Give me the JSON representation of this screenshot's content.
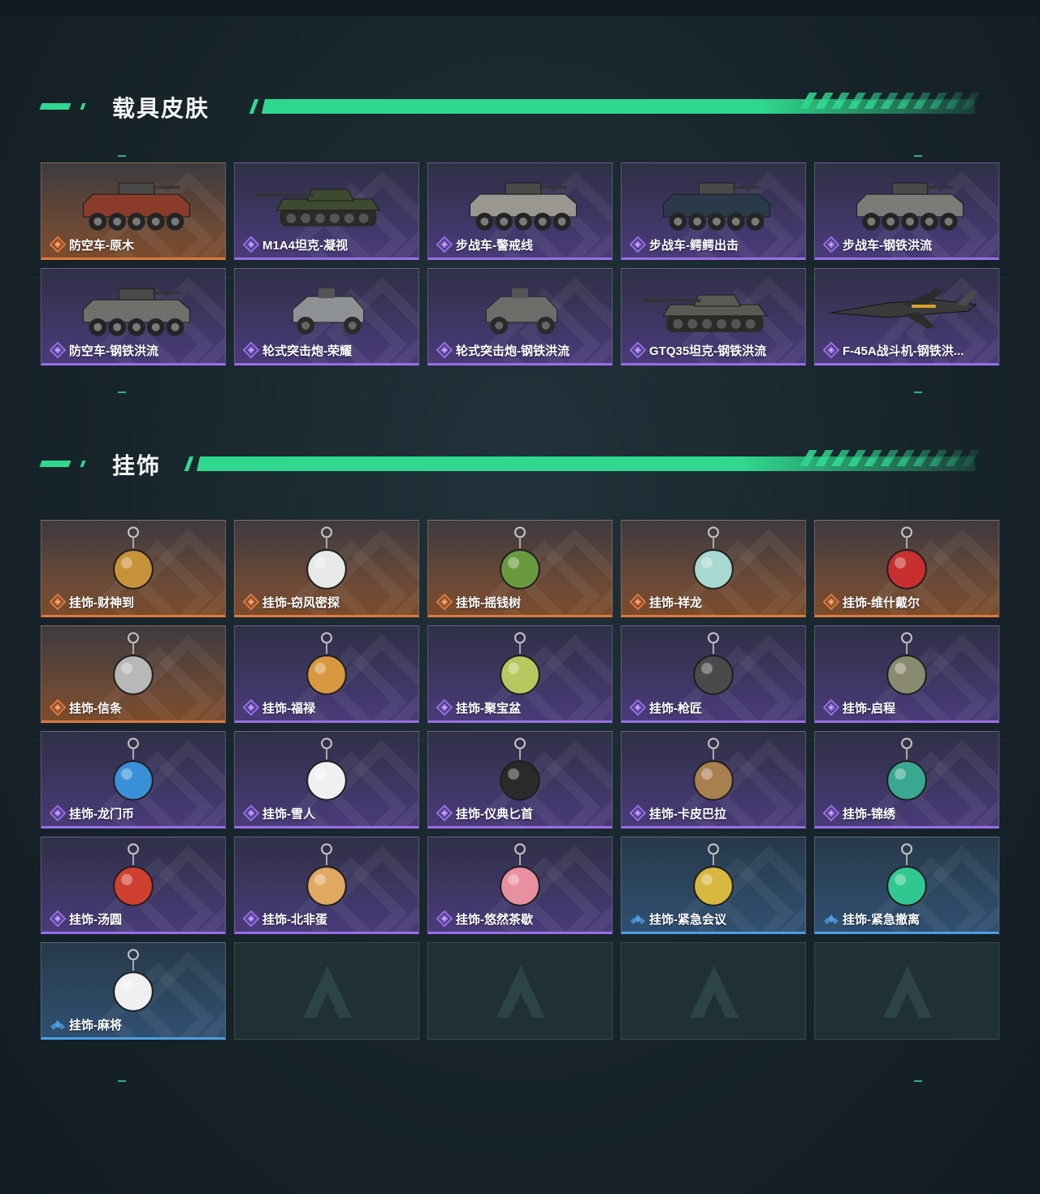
{
  "sections": {
    "vehicle_skins": {
      "title": "载具皮肤",
      "items": [
        {
          "label": "防空车-原木",
          "rarity": "orange",
          "icon": "apc-icon",
          "color": "#8a3b2a"
        },
        {
          "label": "M1A4坦克-凝视",
          "rarity": "purple",
          "icon": "tank-icon",
          "color": "#3e4a30"
        },
        {
          "label": "步战车-警戒线",
          "rarity": "purple",
          "icon": "apc-icon",
          "color": "#9a9690"
        },
        {
          "label": "步战车-鳄鳄出击",
          "rarity": "purple",
          "icon": "apc-icon",
          "color": "#2a3a4a"
        },
        {
          "label": "步战车-钢铁洪流",
          "rarity": "purple",
          "icon": "apc-icon",
          "color": "#7b7b78"
        },
        {
          "label": "防空车-钢铁洪流",
          "rarity": "purple",
          "icon": "apc-icon",
          "color": "#6f6f6c"
        },
        {
          "label": "轮式突击炮-荣耀",
          "rarity": "purple",
          "icon": "armored-car-icon",
          "color": "#8e9294"
        },
        {
          "label": "轮式突击炮-钢铁洪流",
          "rarity": "purple",
          "icon": "armored-car-icon",
          "color": "#6c6c69"
        },
        {
          "label": "GTQ35坦克-钢铁洪流",
          "rarity": "purple",
          "icon": "tank-icon",
          "color": "#5a5a55"
        },
        {
          "label": "F-45A战斗机-钢铁洪...",
          "rarity": "purple",
          "icon": "jet-icon",
          "color": "#3a3a3a"
        }
      ]
    },
    "charms": {
      "title": "挂饰",
      "items": [
        {
          "label": "挂饰-财神到",
          "rarity": "orange",
          "icon": "charm-icon",
          "color": "#c8923a"
        },
        {
          "label": "挂饰-窃风密探",
          "rarity": "orange",
          "icon": "charm-icon",
          "color": "#e8e8e8"
        },
        {
          "label": "挂饰-摇钱树",
          "rarity": "orange",
          "icon": "charm-icon",
          "color": "#6a9a40"
        },
        {
          "label": "挂饰-祥龙",
          "rarity": "orange",
          "icon": "charm-icon",
          "color": "#a8d8d0"
        },
        {
          "label": "挂饰-维什戴尔",
          "rarity": "orange",
          "icon": "charm-icon",
          "color": "#c83030"
        },
        {
          "label": "挂饰-信条",
          "rarity": "orange",
          "icon": "charm-icon",
          "color": "#b8b8b8"
        },
        {
          "label": "挂饰-福禄",
          "rarity": "purple",
          "icon": "charm-icon",
          "color": "#d89840"
        },
        {
          "label": "挂饰-聚宝盆",
          "rarity": "purple",
          "icon": "charm-icon",
          "color": "#b8c860"
        },
        {
          "label": "挂饰-枪匠",
          "rarity": "purple",
          "icon": "charm-icon",
          "color": "#4a4a4a"
        },
        {
          "label": "挂饰-启程",
          "rarity": "purple",
          "icon": "charm-icon",
          "color": "#8a8a70"
        },
        {
          "label": "挂饰-龙门币",
          "rarity": "purple",
          "icon": "charm-icon",
          "color": "#3a90d8"
        },
        {
          "label": "挂饰-雪人",
          "rarity": "purple",
          "icon": "charm-icon",
          "color": "#f0f0f0"
        },
        {
          "label": "挂饰-仪典匕首",
          "rarity": "purple",
          "icon": "charm-icon",
          "color": "#2a2a2a"
        },
        {
          "label": "挂饰-卡皮巴拉",
          "rarity": "purple",
          "icon": "charm-icon",
          "color": "#a88050"
        },
        {
          "label": "挂饰-锦绣",
          "rarity": "purple",
          "icon": "charm-icon",
          "color": "#3aa890"
        },
        {
          "label": "挂饰-汤圆",
          "rarity": "purple",
          "icon": "charm-icon",
          "color": "#d04030"
        },
        {
          "label": "挂饰-北非蛋",
          "rarity": "purple",
          "icon": "charm-icon",
          "color": "#e0a860"
        },
        {
          "label": "挂饰-悠然茶歇",
          "rarity": "purple",
          "icon": "charm-icon",
          "color": "#e890a0"
        },
        {
          "label": "挂饰-紧急会议",
          "rarity": "blue",
          "icon": "charm-icon",
          "color": "#d8b840"
        },
        {
          "label": "挂饰-紧急撤离",
          "rarity": "blue",
          "icon": "charm-icon",
          "color": "#30c890"
        },
        {
          "label": "挂饰-麻将",
          "rarity": "blue",
          "icon": "charm-icon",
          "color": "#f0f0f0"
        },
        {
          "label": "",
          "rarity": "empty",
          "icon": "game-logo-icon",
          "color": ""
        },
        {
          "label": "",
          "rarity": "empty",
          "icon": "game-logo-icon",
          "color": ""
        },
        {
          "label": "",
          "rarity": "empty",
          "icon": "game-logo-icon",
          "color": ""
        },
        {
          "label": "",
          "rarity": "empty",
          "icon": "game-logo-icon",
          "color": ""
        }
      ]
    }
  },
  "colors": {
    "accent": "#2fd88e",
    "rarity_orange": "#e07a3c",
    "rarity_purple": "#9a6ee8",
    "rarity_blue": "#4d9ee4"
  }
}
